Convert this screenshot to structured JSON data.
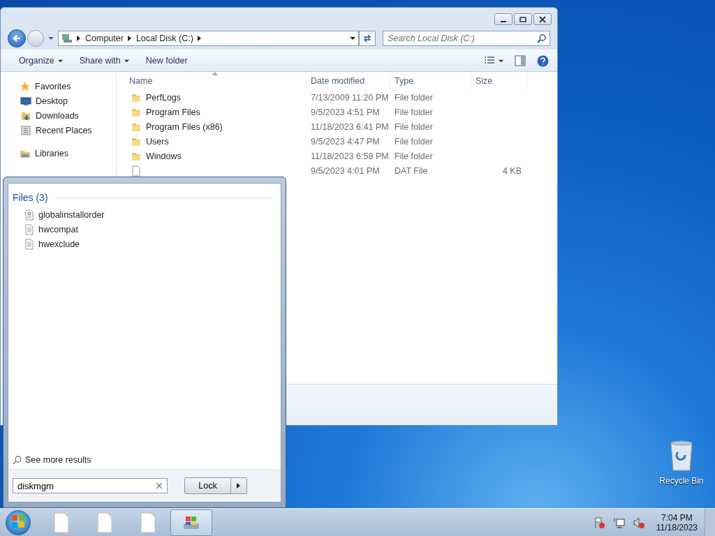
{
  "explorer": {
    "address": {
      "crumbs": [
        "Computer",
        "Local Disk (C:)"
      ]
    },
    "search": {
      "placeholder": "Search Local Disk (C:)"
    },
    "toolbar": [
      {
        "label": "Organize",
        "dropdown": true
      },
      {
        "label": "Share with",
        "dropdown": true
      },
      {
        "label": "New folder",
        "dropdown": false
      }
    ],
    "nav": [
      {
        "label": "Favorites",
        "kind": "star",
        "children": [
          {
            "label": "Desktop",
            "kind": "desktop"
          },
          {
            "label": "Downloads",
            "kind": "downloads"
          },
          {
            "label": "Recent Places",
            "kind": "recent"
          }
        ]
      },
      {
        "label": "Libraries",
        "kind": "libraries"
      }
    ],
    "columns": [
      "Name",
      "Date modified",
      "Type",
      "Size"
    ],
    "rows": [
      {
        "name": "PerfLogs",
        "date": "7/13/2009 11:20 PM",
        "type": "File folder",
        "kind": "folder"
      },
      {
        "name": "Program Files",
        "date": "9/5/2023 4:51 PM",
        "type": "File folder",
        "kind": "folder"
      },
      {
        "name": "Program Files (x86)",
        "date": "11/18/2023 6:41 PM",
        "type": "File folder",
        "kind": "folder"
      },
      {
        "name": "Users",
        "date": "9/5/2023 4:47 PM",
        "type": "File folder",
        "kind": "folder"
      },
      {
        "name": "Windows",
        "date": "11/18/2023 6:58 PM",
        "type": "File folder",
        "kind": "folder"
      },
      {
        "date": "9/5/2023 4:01 PM",
        "type": "DAT File",
        "size": "4 KB",
        "kind": "file"
      }
    ]
  },
  "start_menu": {
    "section_title": "Files (3)",
    "results": [
      {
        "name": "globalinstallorder",
        "kind": "config"
      },
      {
        "name": "hwcompat",
        "kind": "text"
      },
      {
        "name": "hwexclude",
        "kind": "text"
      }
    ],
    "see_more": "See more results",
    "search": {
      "value": "diskmgm"
    },
    "power_button": "Lock"
  },
  "desktop": {
    "icons": [
      {
        "label": "Recycle Bin"
      }
    ]
  },
  "taskbar": {
    "items": [
      {
        "kind": "document",
        "selected": false
      },
      {
        "kind": "document",
        "selected": false
      },
      {
        "kind": "document",
        "selected": false
      },
      {
        "kind": "explorer",
        "selected": true
      }
    ],
    "clock": {
      "time": "7:04 PM",
      "date": "11/18/2023"
    }
  }
}
